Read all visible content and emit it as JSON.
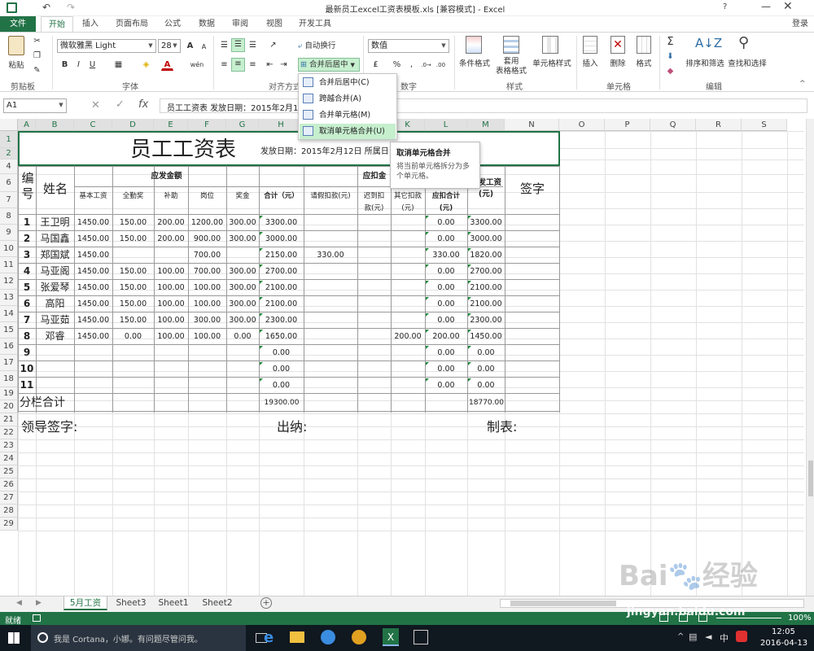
{
  "title_bar": {
    "title": "最新员工excel工资表模板.xls  [兼容模式] - Excel",
    "help": "?",
    "login": "登录"
  },
  "ribbon_tabs": [
    "文件",
    "开始",
    "插入",
    "页面布局",
    "公式",
    "数据",
    "审阅",
    "视图",
    "开发工具"
  ],
  "active_tab": "开始",
  "ribbon": {
    "clipboard": {
      "paste": "粘贴",
      "group": "剪贴板"
    },
    "font": {
      "name": "微软雅黑 Light",
      "size": "28",
      "group": "字体",
      "bold": "B",
      "italic": "I",
      "underline": "U",
      "font_color": "A",
      "grow": "A",
      "shrink": "A",
      "wen": "wén"
    },
    "alignment": {
      "wrap": "自动换行",
      "merge": "合并后居中",
      "group": "对齐方式"
    },
    "number": {
      "format": "数值",
      "group": "数字",
      "percent": "%",
      "comma": ","
    },
    "styles": {
      "cond": "条件格式",
      "table": "套用\n表格格式",
      "cell": "单元格样式",
      "group": "样式"
    },
    "cells": {
      "insert": "插入",
      "delete": "删除",
      "format": "格式",
      "group": "单元格"
    },
    "editing": {
      "sort": "排序和筛选",
      "find": "查找和选择",
      "group": "编辑"
    }
  },
  "formula_bar": {
    "name_box": "A1",
    "fx": "fx",
    "content": "员工工资表    发放日期：2015年2月12日  所属日期：2015年1月"
  },
  "merge_menu": {
    "items": [
      "合并后居中(C)",
      "跨越合并(A)",
      "合并单元格(M)",
      "取消单元格合并(U)"
    ],
    "tooltip_title": "取消单元格合并",
    "tooltip_body": "将当前单元格拆分为多个单元格。"
  },
  "columns": [
    "A",
    "B",
    "C",
    "D",
    "E",
    "F",
    "G",
    "H",
    "I",
    "J",
    "K",
    "L",
    "M",
    "N",
    "O",
    "P",
    "Q",
    "R",
    "S"
  ],
  "rows": [
    "1",
    "2",
    "4",
    "6",
    "7",
    "8",
    "9",
    "10",
    "11",
    "12",
    "13",
    "14",
    "15",
    "16",
    "17",
    "18",
    "19",
    "20",
    "21",
    "22",
    "23",
    "24",
    "25",
    "26",
    "27",
    "28",
    "29"
  ],
  "sheet": {
    "title": "员工工资表",
    "date_text": "发放日期：2015年2月12日  所属日",
    "h_num": "编\n号",
    "h_name": "姓名",
    "h_gross": "应发金额",
    "h_deduct": "应扣金",
    "h_net": "实发工资\n(元)",
    "h_sign": "签字",
    "sub_headers": [
      "基本工资",
      "全勤奖",
      "补助",
      "岗位",
      "奖金",
      "合计（元）",
      "请假扣款(元)",
      "迟到扣\n款(元)",
      "其它扣款\n(元)",
      "应扣合计\n(元)"
    ],
    "data_rows": [
      [
        "1",
        "王卫明",
        "1450.00",
        "150.00",
        "200.00",
        "1200.00",
        "300.00",
        "3300.00",
        "",
        "",
        "",
        "0.00",
        "3300.00"
      ],
      [
        "2",
        "马国鑫",
        "1450.00",
        "150.00",
        "200.00",
        "900.00",
        "300.00",
        "3000.00",
        "",
        "",
        "",
        "0.00",
        "3000.00"
      ],
      [
        "3",
        "郑国斌",
        "1450.00",
        "",
        "",
        "700.00",
        "",
        "2150.00",
        "330.00",
        "",
        "",
        "330.00",
        "1820.00"
      ],
      [
        "4",
        "马亚阁",
        "1450.00",
        "150.00",
        "100.00",
        "700.00",
        "300.00",
        "2700.00",
        "",
        "",
        "",
        "0.00",
        "2700.00"
      ],
      [
        "5",
        "张爱琴",
        "1450.00",
        "150.00",
        "100.00",
        "100.00",
        "300.00",
        "2100.00",
        "",
        "",
        "",
        "0.00",
        "2100.00"
      ],
      [
        "6",
        "高阳",
        "1450.00",
        "150.00",
        "100.00",
        "100.00",
        "300.00",
        "2100.00",
        "",
        "",
        "",
        "0.00",
        "2100.00"
      ],
      [
        "7",
        "马亚茹",
        "1450.00",
        "150.00",
        "100.00",
        "300.00",
        "300.00",
        "2300.00",
        "",
        "",
        "",
        "0.00",
        "2300.00"
      ],
      [
        "8",
        "邓睿",
        "1450.00",
        "0.00",
        "100.00",
        "100.00",
        "0.00",
        "1650.00",
        "",
        "",
        "200.00",
        "200.00",
        "1450.00"
      ],
      [
        "9",
        "",
        "",
        "",
        "",
        "",
        "",
        "0.00",
        "",
        "",
        "",
        "0.00",
        "0.00"
      ],
      [
        "10",
        "",
        "",
        "",
        "",
        "",
        "",
        "0.00",
        "",
        "",
        "",
        "0.00",
        "0.00"
      ],
      [
        "11",
        "",
        "",
        "",
        "",
        "",
        "",
        "0.00",
        "",
        "",
        "",
        "0.00",
        "0.00"
      ]
    ],
    "total_label": "分栏合计",
    "total_gross": "19300.00",
    "total_net": "18770.00",
    "footer": {
      "leader": "领导签字:",
      "cashier": "出纳:",
      "maker": "制表:"
    }
  },
  "sheet_tabs": [
    "5月工资",
    "Sheet3",
    "Sheet1",
    "Sheet2"
  ],
  "status": {
    "ready": "就绪",
    "zoom": "100%"
  },
  "taskbar": {
    "cortana": "我是 Cortana，小娜。有问题尽管问我。",
    "time": "12:05",
    "date": "2016-04-13",
    "ime": "中"
  },
  "watermark": "jingyan.baidu.com",
  "colors": {
    "excel_green": "#217346",
    "accent": "#1f8a3b",
    "selection": "#c6efce"
  }
}
